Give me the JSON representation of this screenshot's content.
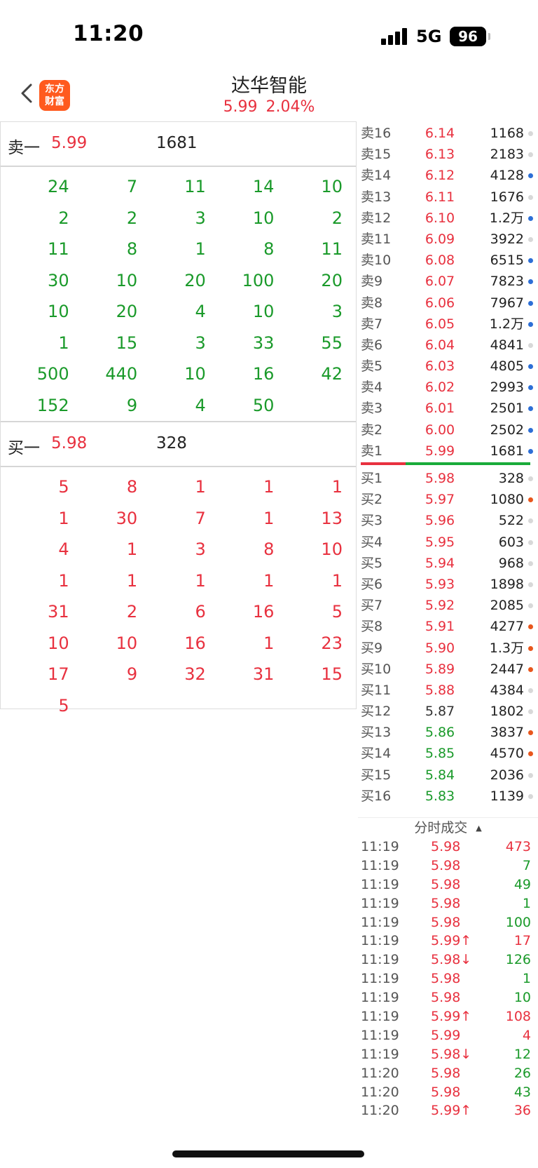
{
  "status": {
    "time": "11:20",
    "network": "5G",
    "battery": "96"
  },
  "header": {
    "logo_line1": "东方",
    "logo_line2": "财富",
    "name": "达华智能",
    "price": "5.99",
    "change_pct": "2.04%"
  },
  "sell_one": {
    "label": "卖一",
    "price": "5.99",
    "volume": "1681"
  },
  "sell_queue": [
    [
      "24",
      "7",
      "11",
      "14",
      "10"
    ],
    [
      "2",
      "2",
      "3",
      "10",
      "2"
    ],
    [
      "11",
      "8",
      "1",
      "8",
      "11"
    ],
    [
      "30",
      "10",
      "20",
      "100",
      "20"
    ],
    [
      "10",
      "20",
      "4",
      "10",
      "3"
    ],
    [
      "1",
      "15",
      "3",
      "33",
      "55"
    ],
    [
      "500",
      "440",
      "10",
      "16",
      "42"
    ],
    [
      "152",
      "9",
      "4",
      "50",
      ""
    ]
  ],
  "buy_one": {
    "label": "买一",
    "price": "5.98",
    "volume": "328"
  },
  "buy_queue": [
    [
      "5",
      "8",
      "1",
      "1",
      "1"
    ],
    [
      "1",
      "30",
      "7",
      "1",
      "13"
    ],
    [
      "4",
      "1",
      "3",
      "8",
      "10"
    ],
    [
      "1",
      "1",
      "1",
      "1",
      "1"
    ],
    [
      "31",
      "2",
      "6",
      "16",
      "5"
    ],
    [
      "10",
      "10",
      "16",
      "1",
      "23"
    ],
    [
      "17",
      "9",
      "32",
      "31",
      "15"
    ],
    [
      "5",
      "",
      "",
      "",
      ""
    ]
  ],
  "colors": {
    "red": "#e8313f",
    "green": "#1a9a2a",
    "blue_dot": "#2d6fd6",
    "orange_dot": "#e8561c",
    "grey_dot": "#d8d8d8",
    "logo": "#ff5a1e"
  },
  "asks": [
    {
      "label": "卖16",
      "price": "6.14",
      "vol": "1168",
      "dot": "grey"
    },
    {
      "label": "卖15",
      "price": "6.13",
      "vol": "2183",
      "dot": "grey"
    },
    {
      "label": "卖14",
      "price": "6.12",
      "vol": "4128",
      "dot": "blue"
    },
    {
      "label": "卖13",
      "price": "6.11",
      "vol": "1676",
      "dot": "grey"
    },
    {
      "label": "卖12",
      "price": "6.10",
      "vol": "1.2万",
      "dot": "blue"
    },
    {
      "label": "卖11",
      "price": "6.09",
      "vol": "3922",
      "dot": "grey"
    },
    {
      "label": "卖10",
      "price": "6.08",
      "vol": "6515",
      "dot": "blue"
    },
    {
      "label": "卖9",
      "price": "6.07",
      "vol": "7823",
      "dot": "blue"
    },
    {
      "label": "卖8",
      "price": "6.06",
      "vol": "7967",
      "dot": "blue"
    },
    {
      "label": "卖7",
      "price": "6.05",
      "vol": "1.2万",
      "dot": "blue"
    },
    {
      "label": "卖6",
      "price": "6.04",
      "vol": "4841",
      "dot": "grey"
    },
    {
      "label": "卖5",
      "price": "6.03",
      "vol": "4805",
      "dot": "blue"
    },
    {
      "label": "卖4",
      "price": "6.02",
      "vol": "2993",
      "dot": "blue"
    },
    {
      "label": "卖3",
      "price": "6.01",
      "vol": "2501",
      "dot": "blue"
    },
    {
      "label": "卖2",
      "price": "6.00",
      "vol": "2502",
      "dot": "blue"
    },
    {
      "label": "卖1",
      "price": "5.99",
      "vol": "1681",
      "dot": "blue"
    }
  ],
  "bids": [
    {
      "label": "买1",
      "price": "5.98",
      "vol": "328",
      "dot": "grey",
      "pc": "red"
    },
    {
      "label": "买2",
      "price": "5.97",
      "vol": "1080",
      "dot": "orange",
      "pc": "red"
    },
    {
      "label": "买3",
      "price": "5.96",
      "vol": "522",
      "dot": "grey",
      "pc": "red"
    },
    {
      "label": "买4",
      "price": "5.95",
      "vol": "603",
      "dot": "grey",
      "pc": "red"
    },
    {
      "label": "买5",
      "price": "5.94",
      "vol": "968",
      "dot": "grey",
      "pc": "red"
    },
    {
      "label": "买6",
      "price": "5.93",
      "vol": "1898",
      "dot": "grey",
      "pc": "red"
    },
    {
      "label": "买7",
      "price": "5.92",
      "vol": "2085",
      "dot": "grey",
      "pc": "red"
    },
    {
      "label": "买8",
      "price": "5.91",
      "vol": "4277",
      "dot": "orange",
      "pc": "red"
    },
    {
      "label": "买9",
      "price": "5.90",
      "vol": "1.3万",
      "dot": "orange",
      "pc": "red"
    },
    {
      "label": "买10",
      "price": "5.89",
      "vol": "2447",
      "dot": "orange",
      "pc": "red"
    },
    {
      "label": "买11",
      "price": "5.88",
      "vol": "4384",
      "dot": "grey",
      "pc": "red"
    },
    {
      "label": "买12",
      "price": "5.87",
      "vol": "1802",
      "dot": "grey",
      "pc": "dark"
    },
    {
      "label": "买13",
      "price": "5.86",
      "vol": "3837",
      "dot": "orange",
      "pc": "green"
    },
    {
      "label": "买14",
      "price": "5.85",
      "vol": "4570",
      "dot": "orange",
      "pc": "green"
    },
    {
      "label": "买15",
      "price": "5.84",
      "vol": "2036",
      "dot": "grey",
      "pc": "green"
    },
    {
      "label": "买16",
      "price": "5.83",
      "vol": "1139",
      "dot": "grey",
      "pc": "green"
    }
  ],
  "ticks_title": "分时成交",
  "ticks": [
    {
      "time": "11:19",
      "price": "5.98",
      "vol": "473",
      "vc": "red"
    },
    {
      "time": "11:19",
      "price": "5.98",
      "vol": "7",
      "vc": "green"
    },
    {
      "time": "11:19",
      "price": "5.98",
      "vol": "49",
      "vc": "green"
    },
    {
      "time": "11:19",
      "price": "5.98",
      "vol": "1",
      "vc": "green"
    },
    {
      "time": "11:19",
      "price": "5.98",
      "vol": "100",
      "vc": "green"
    },
    {
      "time": "11:19",
      "price": "5.99↑",
      "vol": "17",
      "vc": "red"
    },
    {
      "time": "11:19",
      "price": "5.98↓",
      "vol": "126",
      "vc": "green"
    },
    {
      "time": "11:19",
      "price": "5.98",
      "vol": "1",
      "vc": "green"
    },
    {
      "time": "11:19",
      "price": "5.98",
      "vol": "10",
      "vc": "green"
    },
    {
      "time": "11:19",
      "price": "5.99↑",
      "vol": "108",
      "vc": "red"
    },
    {
      "time": "11:19",
      "price": "5.99",
      "vol": "4",
      "vc": "red"
    },
    {
      "time": "11:19",
      "price": "5.98↓",
      "vol": "12",
      "vc": "green"
    },
    {
      "time": "11:20",
      "price": "5.98",
      "vol": "26",
      "vc": "green"
    },
    {
      "time": "11:20",
      "price": "5.98",
      "vol": "43",
      "vc": "green"
    },
    {
      "time": "11:20",
      "price": "5.99↑",
      "vol": "36",
      "vc": "red"
    }
  ]
}
